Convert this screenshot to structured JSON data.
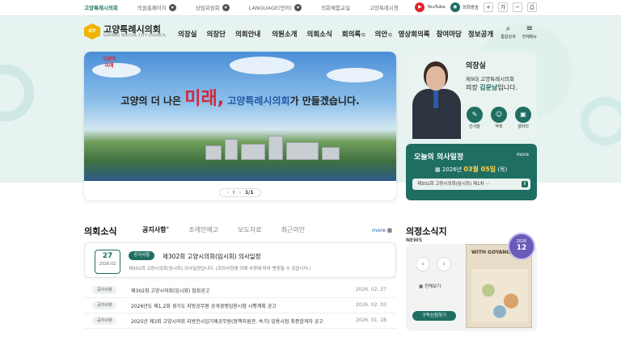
{
  "topbar": {
    "links": [
      {
        "label": "고양특례시의회",
        "active": true,
        "has_icon": false
      },
      {
        "label": "의원홈페이지",
        "active": false,
        "has_icon": true
      },
      {
        "label": "상임위원회",
        "active": false,
        "has_icon": true
      },
      {
        "label": "LANGUAGE(언어)",
        "active": false,
        "has_icon": true
      },
      {
        "label": "의회체험교실",
        "active": false,
        "has_icon": false
      },
      {
        "label": "고양특례시청",
        "active": false,
        "has_icon": false
      }
    ],
    "youtube_label": "YouTube",
    "broadcast_label": "의회방송",
    "zoom_in": "+",
    "zoom_reset": "가",
    "zoom_out": "−",
    "print_icon": "⎙"
  },
  "header": {
    "logo_name": "고양특례시의회",
    "logo_sub": "GOYANG SPECIAL CITY COUNCIL",
    "nav": [
      "의장실",
      "의장단",
      "의회안내",
      "의원소개",
      "의회소식",
      "회의록",
      "의안",
      "영상회의록",
      "참여마당",
      "정보공개"
    ],
    "tools": [
      {
        "label": "통합검색",
        "icon": "⌕"
      },
      {
        "label": "전체메뉴",
        "icon": "≡"
      }
    ]
  },
  "hero": {
    "slogan_pre": "고양의 더 나은",
    "slogan_big": "미래,",
    "slogan_council": "고양특례시의회",
    "slogan_post": "가 만들겠습니다.",
    "pager": "1/1",
    "pager_prev": "‹",
    "pager_pause": "Ⅱ",
    "pager_next": "›"
  },
  "chairman": {
    "title": "의장실",
    "term": "제9대 고양특례시의회",
    "name_pre": "의장",
    "name": "김운남",
    "name_post": "입니다.",
    "buttons": [
      {
        "label": "인사말",
        "icon": "✎"
      },
      {
        "label": "약력",
        "icon": "☺"
      },
      {
        "label": "갤러리",
        "icon": "▣"
      }
    ]
  },
  "schedule": {
    "title": "오늘의 의사일정",
    "more": "more",
    "date_pre": "2026년",
    "date_md": "03월 05일",
    "date_dow": "(목)",
    "event": "제302회 고양시의회(임시회) 제1차 ···",
    "pause": "Ⅱ"
  },
  "news": {
    "title": "의회소식",
    "tabs": [
      {
        "label": "공지사항",
        "active": true
      },
      {
        "label": "조례안예고",
        "active": false
      },
      {
        "label": "보도자료",
        "active": false
      },
      {
        "label": "최근의안",
        "active": false
      }
    ],
    "more": "more",
    "featured": {
      "day": "27",
      "ym": "2026.02",
      "badge": "공지사항",
      "title": "제302회 고양시의회(임시회) 의사일정",
      "desc": "제302회 고양시의회(임시회) 의사일정입니다. (회의사정에 의해 사정에 따라 변동될 수 있습니다.)"
    },
    "rows": [
      {
        "badge": "공지사항",
        "title": "제302회 고양시의회(임시회) 집회공고",
        "date": "2026. 02. 27"
      },
      {
        "badge": "공지사항",
        "title": "2026년도 제1,2회 경기도 지방공무원 공개경쟁임용시험 시행계획 공고",
        "date": "2026. 02. 03"
      },
      {
        "badge": "공지사항",
        "title": "2025년 제3회 고양시의회 지방전시임기제공무원(정책지원관, 속기) 임용시험 최종합격자 공고",
        "date": "2026. 01. 28"
      }
    ]
  },
  "magazine": {
    "title": "의정소식지",
    "sub": "NEWS",
    "prev": "‹",
    "next": "›",
    "all": "전체보기",
    "subscribe": "구독신청하기",
    "cover_title": "WITH GOYANG",
    "issue_year": "2026",
    "issue_month": "12"
  },
  "colors": {
    "accent": "#1f6e62",
    "band": "#e6f3f1",
    "slogan_red": "#d4263a",
    "slogan_blue": "#1f5aa8"
  }
}
